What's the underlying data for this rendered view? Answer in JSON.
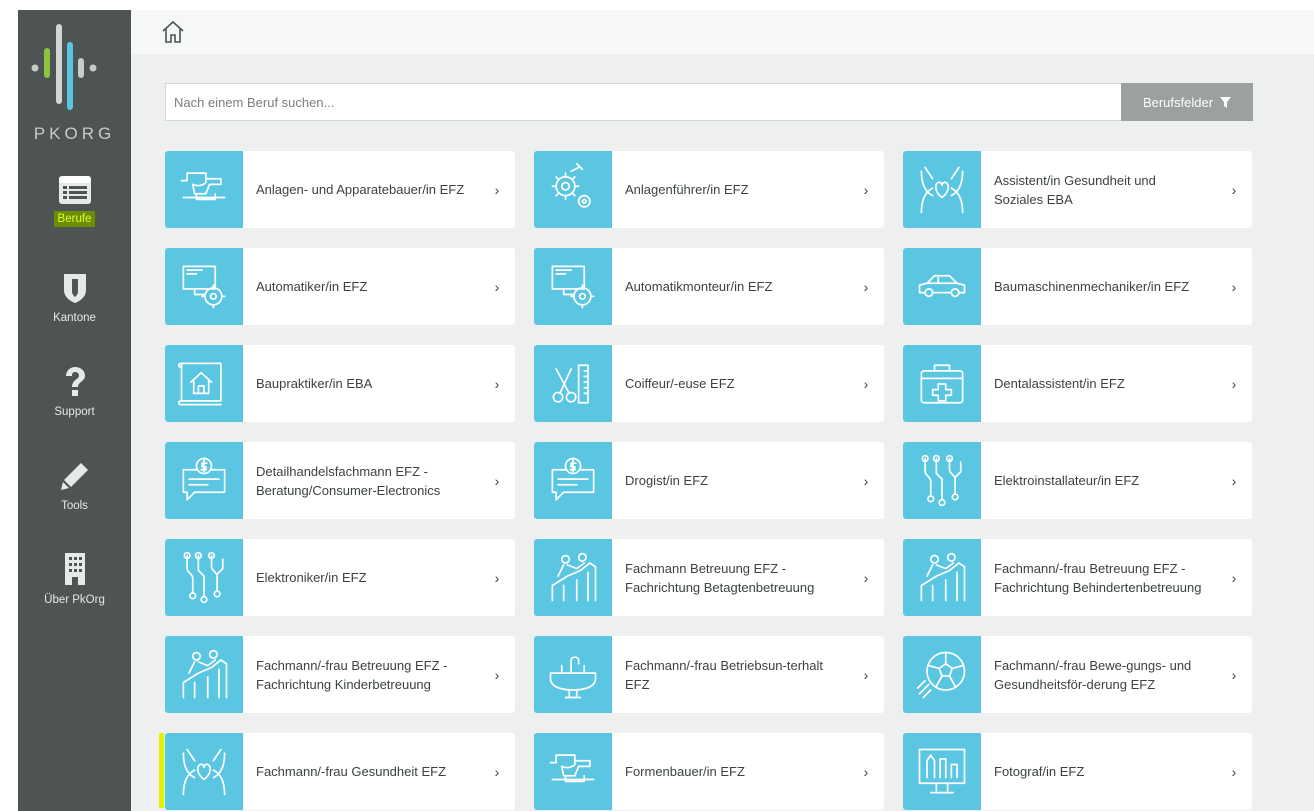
{
  "brand": {
    "name": "PKORG"
  },
  "sidebar": {
    "items": [
      {
        "label": "Berufe",
        "icon": "list-icon",
        "active": true
      },
      {
        "label": "Kantone",
        "icon": "shield-icon"
      },
      {
        "label": "Support",
        "icon": "question-icon"
      },
      {
        "label": "Tools",
        "icon": "pencil-icon"
      },
      {
        "label": "Über PkOrg",
        "icon": "building-icon"
      }
    ]
  },
  "topbar": {
    "home_icon": "home-icon"
  },
  "search": {
    "placeholder": "Nach einem Beruf suchen...",
    "value": ""
  },
  "filter": {
    "label": "Berufsfelder",
    "icon": "filter-icon"
  },
  "colors": {
    "sidebar": "#4d5453",
    "accent": "#5ac6e2",
    "filter": "#9aa19f",
    "highlight": "#6e8d00"
  },
  "professions": [
    {
      "title": "Anlagen- und Apparatebauer/in EFZ",
      "icon": "anvil-icon"
    },
    {
      "title": "Anlagenführer/in EFZ",
      "icon": "gears-icon"
    },
    {
      "title": "Assistent/in Gesundheit und Soziales EBA",
      "icon": "caring-hands-icon"
    },
    {
      "title": "Automatiker/in EFZ",
      "icon": "monitor-gear-icon"
    },
    {
      "title": "Automatikmonteur/in EFZ",
      "icon": "monitor-gear-icon"
    },
    {
      "title": "Baumaschinenmechaniker/in EFZ",
      "icon": "car-icon"
    },
    {
      "title": "Baupraktiker/in EBA",
      "icon": "house-plan-icon"
    },
    {
      "title": "Coiffeur/-euse EFZ",
      "icon": "scissors-comb-icon"
    },
    {
      "title": "Dentalassistent/in EFZ",
      "icon": "first-aid-kit-icon"
    },
    {
      "title": "Detailhandelsfachmann EFZ - Beratung/Consumer-Electronics",
      "icon": "money-chat-icon"
    },
    {
      "title": "Drogist/in EFZ",
      "icon": "money-chat-icon"
    },
    {
      "title": "Elektroinstallateur/in EFZ",
      "icon": "circuit-icon"
    },
    {
      "title": "Elektroniker/in EFZ",
      "icon": "circuit-icon"
    },
    {
      "title": "Fachmann Betreuung EFZ - Fachrichtung Betagtenbetreuung",
      "icon": "helping-stairs-icon"
    },
    {
      "title": "Fachmann/-frau Betreuung EFZ - Fachrichtung Behindertenbetreuung",
      "icon": "helping-stairs-icon"
    },
    {
      "title": "Fachmann/-frau Betreuung EFZ - Fachrichtung Kinderbetreuung",
      "icon": "helping-stairs-icon"
    },
    {
      "title": "Fachmann/-frau Betriebsun-terhalt EFZ",
      "icon": "sink-icon"
    },
    {
      "title": "Fachmann/-frau Bewe-gungs- und Gesundheitsför-derung EFZ",
      "icon": "soccer-ball-icon"
    },
    {
      "title": "Fachmann/-frau Gesundheit EFZ",
      "icon": "caring-hands-icon"
    },
    {
      "title": "Formenbauer/in EFZ",
      "icon": "anvil-icon"
    },
    {
      "title": "Fotograf/in EFZ",
      "icon": "photo-screen-icon"
    }
  ]
}
